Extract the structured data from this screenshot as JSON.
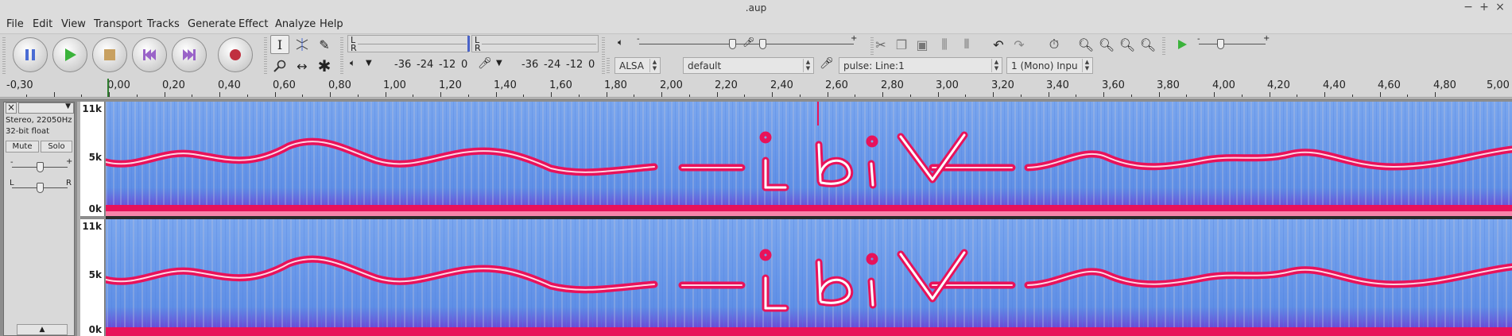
{
  "window": {
    "title": ".aup",
    "controls": [
      "−",
      "+",
      "×"
    ]
  },
  "menu": [
    "File",
    "Edit",
    "View",
    "Transport",
    "Tracks",
    "Generate",
    "Effect",
    "Analyze",
    "Help"
  ],
  "meters": {
    "play_L": "L",
    "play_R": "R",
    "rec_L": "L",
    "rec_R": "R",
    "scale_left": [
      "-36",
      "-24",
      "-12",
      "0"
    ],
    "scale_right": [
      "-36",
      "-24",
      "-12",
      "0"
    ]
  },
  "device": {
    "host": "ALSA",
    "output": "default",
    "input": "pulse: Line:1",
    "channels": "1 (Mono) Inpu"
  },
  "ruler": {
    "labels": [
      "-0,30",
      "0,00",
      "0,20",
      "0,40",
      "0,60",
      "0,80",
      "1,00",
      "1,20",
      "1,40",
      "1,60",
      "1,80",
      "2,00",
      "2,20",
      "2,40",
      "2,60",
      "2,80",
      "3,00",
      "3,20",
      "3,40",
      "3,60",
      "3,80",
      "4,00",
      "4,20",
      "4,40",
      "4,60",
      "4,80",
      "5,00"
    ]
  },
  "track": {
    "close": "×",
    "info_line1": "Stereo, 22050Hz",
    "info_line2": "32-bit float",
    "mute": "Mute",
    "solo": "Solo",
    "gain_minus": "-",
    "gain_plus": "+",
    "pan_L": "L",
    "pan_R": "R",
    "collapse": "▲"
  },
  "vscale": {
    "top": "11k",
    "mid": "5k",
    "bottom": "0k"
  },
  "colors": {
    "spectrogram_bg": "#6fa0ea",
    "spectrogram_hot": "#e8125a",
    "spectrogram_white": "#ffffff",
    "meter_cursor": "#4a63c8",
    "play_green": "#3bb33b",
    "record_red": "#c0303f",
    "pause_blue": "#4a6cd4"
  },
  "icons": {
    "pause": "pause-icon",
    "play": "play-icon",
    "stop": "stop-icon",
    "skip_start": "skip-to-start-icon",
    "skip_end": "skip-to-end-icon",
    "record": "record-icon"
  }
}
